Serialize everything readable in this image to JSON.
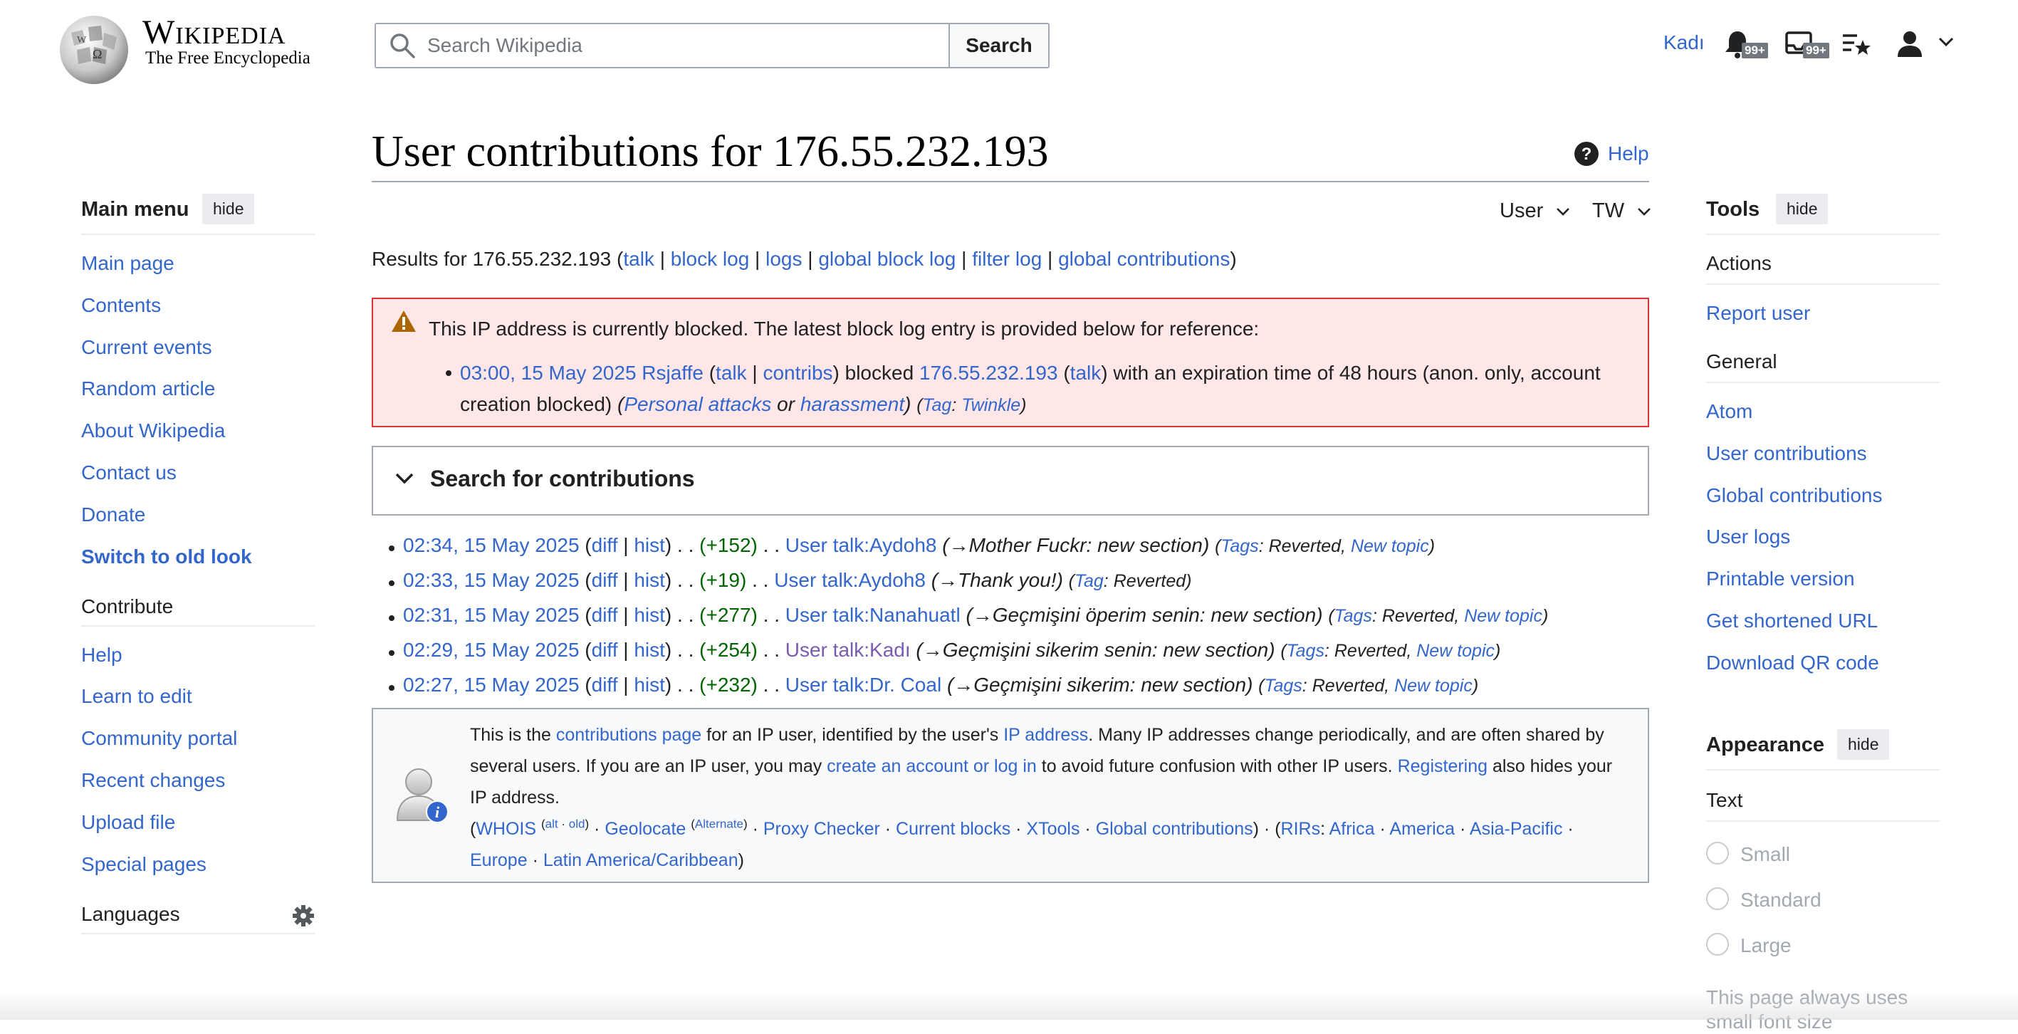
{
  "header": {
    "wordmark": "Wikipedia",
    "tagline": "The Free Encyclopedia",
    "search_placeholder": "Search Wikipedia",
    "search_button": "Search",
    "username": "Kadı",
    "notifications_badge": "99+",
    "messages_badge": "99+"
  },
  "main_menu": {
    "title": "Main menu",
    "hide": "hide",
    "items": [
      "Main page",
      "Contents",
      "Current events",
      "Random article",
      "About Wikipedia",
      "Contact us",
      "Donate"
    ],
    "switch_old": "Switch to old look",
    "contribute_title": "Contribute",
    "contribute_items": [
      "Help",
      "Learn to edit",
      "Community portal",
      "Recent changes",
      "Upload file",
      "Special pages"
    ],
    "languages": "Languages"
  },
  "page": {
    "title": "User contributions for 176.55.232.193",
    "help": "Help",
    "tab_user": "User",
    "tab_tw": "TW",
    "results_prefix": "Results for 176.55.232.193 (",
    "results_links": [
      "talk",
      "block log",
      "logs",
      "global block log",
      "filter log",
      "global contributions"
    ],
    "results_suffix": ")"
  },
  "block_notice": {
    "intro": "This IP address is currently blocked. The latest block log entry is provided below for reference:",
    "timestamp": "03:00, 15 May 2025",
    "admin": "Rsjaffe",
    "talk": "talk",
    "contribs": "contribs",
    "blocked_word": "blocked",
    "ip": "176.55.232.193",
    "ip_talk": "talk",
    "expiry": "with an expiration time of 48 hours (anon. only, account",
    "expiry_line2": "creation blocked)",
    "reason_a": "Personal attacks",
    "reason_or": "or",
    "reason_b": "harassment",
    "tag_label": "Tag",
    "tag_value": "Twinkle"
  },
  "search_contributions": {
    "label": "Search for contributions"
  },
  "contributions": [
    {
      "time": "02:34, 15 May 2025",
      "diff": "diff",
      "hist": "hist",
      "size": "(+152)",
      "page": "User talk:Aydoh8",
      "summary_arrow": "→",
      "summary_section": "Mother Fuckr",
      "summary_rest": ": new section",
      "tags_label": "Tags",
      "tags": [
        "Reverted",
        "New topic"
      ],
      "page_visited": false
    },
    {
      "time": "02:33, 15 May 2025",
      "diff": "diff",
      "hist": "hist",
      "size": "(+19)",
      "page": "User talk:Aydoh8",
      "summary_arrow": "→",
      "summary_section": "Thank you!",
      "summary_rest": "",
      "tags_label": "Tag",
      "tags": [
        "Reverted"
      ],
      "page_visited": false
    },
    {
      "time": "02:31, 15 May 2025",
      "diff": "diff",
      "hist": "hist",
      "size": "(+277)",
      "page": "User talk:Nanahuatl",
      "summary_arrow": "→",
      "summary_section": "Geçmişini öperim senin",
      "summary_rest": ": new section",
      "tags_label": "Tags",
      "tags": [
        "Reverted",
        "New topic"
      ],
      "page_visited": false
    },
    {
      "time": "02:29, 15 May 2025",
      "diff": "diff",
      "hist": "hist",
      "size": "(+254)",
      "page": "User talk:Kadı",
      "summary_arrow": "→",
      "summary_section": "Geçmişini sikerim senin",
      "summary_rest": ": new section",
      "tags_label": "Tags",
      "tags": [
        "Reverted",
        "New topic"
      ],
      "page_visited": true
    },
    {
      "time": "02:27, 15 May 2025",
      "diff": "diff",
      "hist": "hist",
      "size": "(+232)",
      "page": "User talk:Dr. Coal",
      "summary_arrow": "→",
      "summary_section": "Geçmişini sikerim",
      "summary_rest": ": new section",
      "tags_label": "Tags",
      "tags": [
        "Reverted",
        "New topic"
      ],
      "page_visited": false
    }
  ],
  "info_box": {
    "t1": "This is the ",
    "l1": "contributions page",
    "t2": " for an IP user, identified by the user's ",
    "l2": "IP address",
    "t3": ". Many IP addresses change periodically, and are often shared by",
    "t4": "several users. If you are an IP user, you may ",
    "l3": "create an account or log in",
    "t5": " to avoid future confusion with other IP users. ",
    "l4": "Registering",
    "t6": " also hides your",
    "t7": "IP address.",
    "whois": "WHOIS",
    "alt": "alt",
    "old": "old",
    "geolocate": "Geolocate",
    "alternate": "Alternate",
    "proxy": "Proxy Checker",
    "current_blocks": "Current blocks",
    "xtools": "XTools",
    "global_contribs": "Global contributions",
    "rirs": "RIRs",
    "africa": "Africa",
    "america": "America",
    "asia": "Asia-Pacific",
    "europe": "Europe",
    "latam": "Latin America/Caribbean"
  },
  "tools": {
    "title": "Tools",
    "hide": "hide",
    "actions_title": "Actions",
    "actions": [
      "Report user"
    ],
    "general_title": "General",
    "general": [
      "Atom",
      "User contributions",
      "Global contributions",
      "User logs",
      "Printable version",
      "Get shortened URL",
      "Download QR code"
    ]
  },
  "appearance": {
    "title": "Appearance",
    "hide": "hide",
    "text_title": "Text",
    "options": [
      "Small",
      "Standard",
      "Large"
    ],
    "note_line1": "This page always uses",
    "note_line2": "small font size"
  }
}
